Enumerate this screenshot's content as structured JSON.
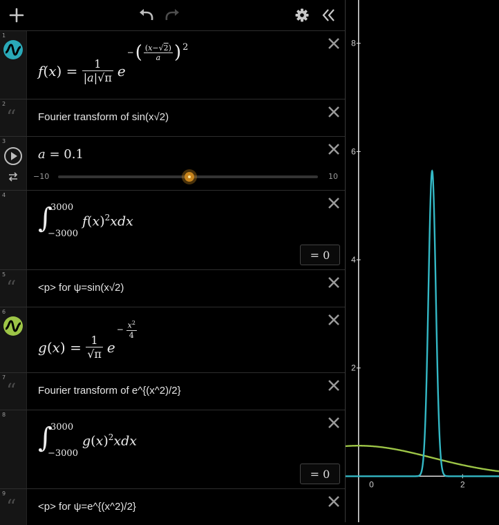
{
  "toolbar": {
    "add_icon": "plus-icon",
    "undo_icon": "undo-icon",
    "redo_icon": "redo-icon",
    "settings_icon": "gear-icon",
    "collapse_icon": "double-chevron-left-icon"
  },
  "expressions": [
    {
      "index": "1",
      "type": "function",
      "latex": "f(x) = 1/(|a|√π) · e^(−((x−√2)/a)^2)",
      "color": "#2aa9b8"
    },
    {
      "index": "2",
      "type": "note",
      "text": "Fourier transform of sin(x√2)"
    },
    {
      "index": "3",
      "type": "slider",
      "variable": "a",
      "value": "0.1",
      "min_label": "−10",
      "max_label": "10",
      "slider_min": -10,
      "slider_max": 10,
      "slider_value": 0.1
    },
    {
      "index": "4",
      "type": "integral",
      "lower": "−3000",
      "upper": "3000",
      "result": "= 0"
    },
    {
      "index": "5",
      "type": "note",
      "text": "<p> for ψ=sin(x√2)"
    },
    {
      "index": "6",
      "type": "function",
      "latex": "g(x) = 1/√π · e^(−x²/4)",
      "color": "#9dc547"
    },
    {
      "index": "7",
      "type": "note",
      "text": "Fourier transform of e^{(x^2)/2}"
    },
    {
      "index": "8",
      "type": "integral",
      "lower": "−3000",
      "upper": "3000",
      "result": "= 0"
    },
    {
      "index": "9",
      "type": "note",
      "text": "<p> for ψ=e^{(x^2)/2}"
    }
  ],
  "graph": {
    "x_tick_labels": [
      "0",
      "2"
    ],
    "y_tick_labels": [
      "2",
      "4",
      "6",
      "8"
    ],
    "x_ticks": [
      0,
      2
    ],
    "y_ticks": [
      2,
      4,
      6,
      8
    ],
    "x_range": [
      -0.25,
      2.7
    ],
    "y_range": [
      -0.85,
      8.8
    ],
    "curve_colors": {
      "f": "#34b9c6",
      "g": "#9dc547"
    }
  }
}
